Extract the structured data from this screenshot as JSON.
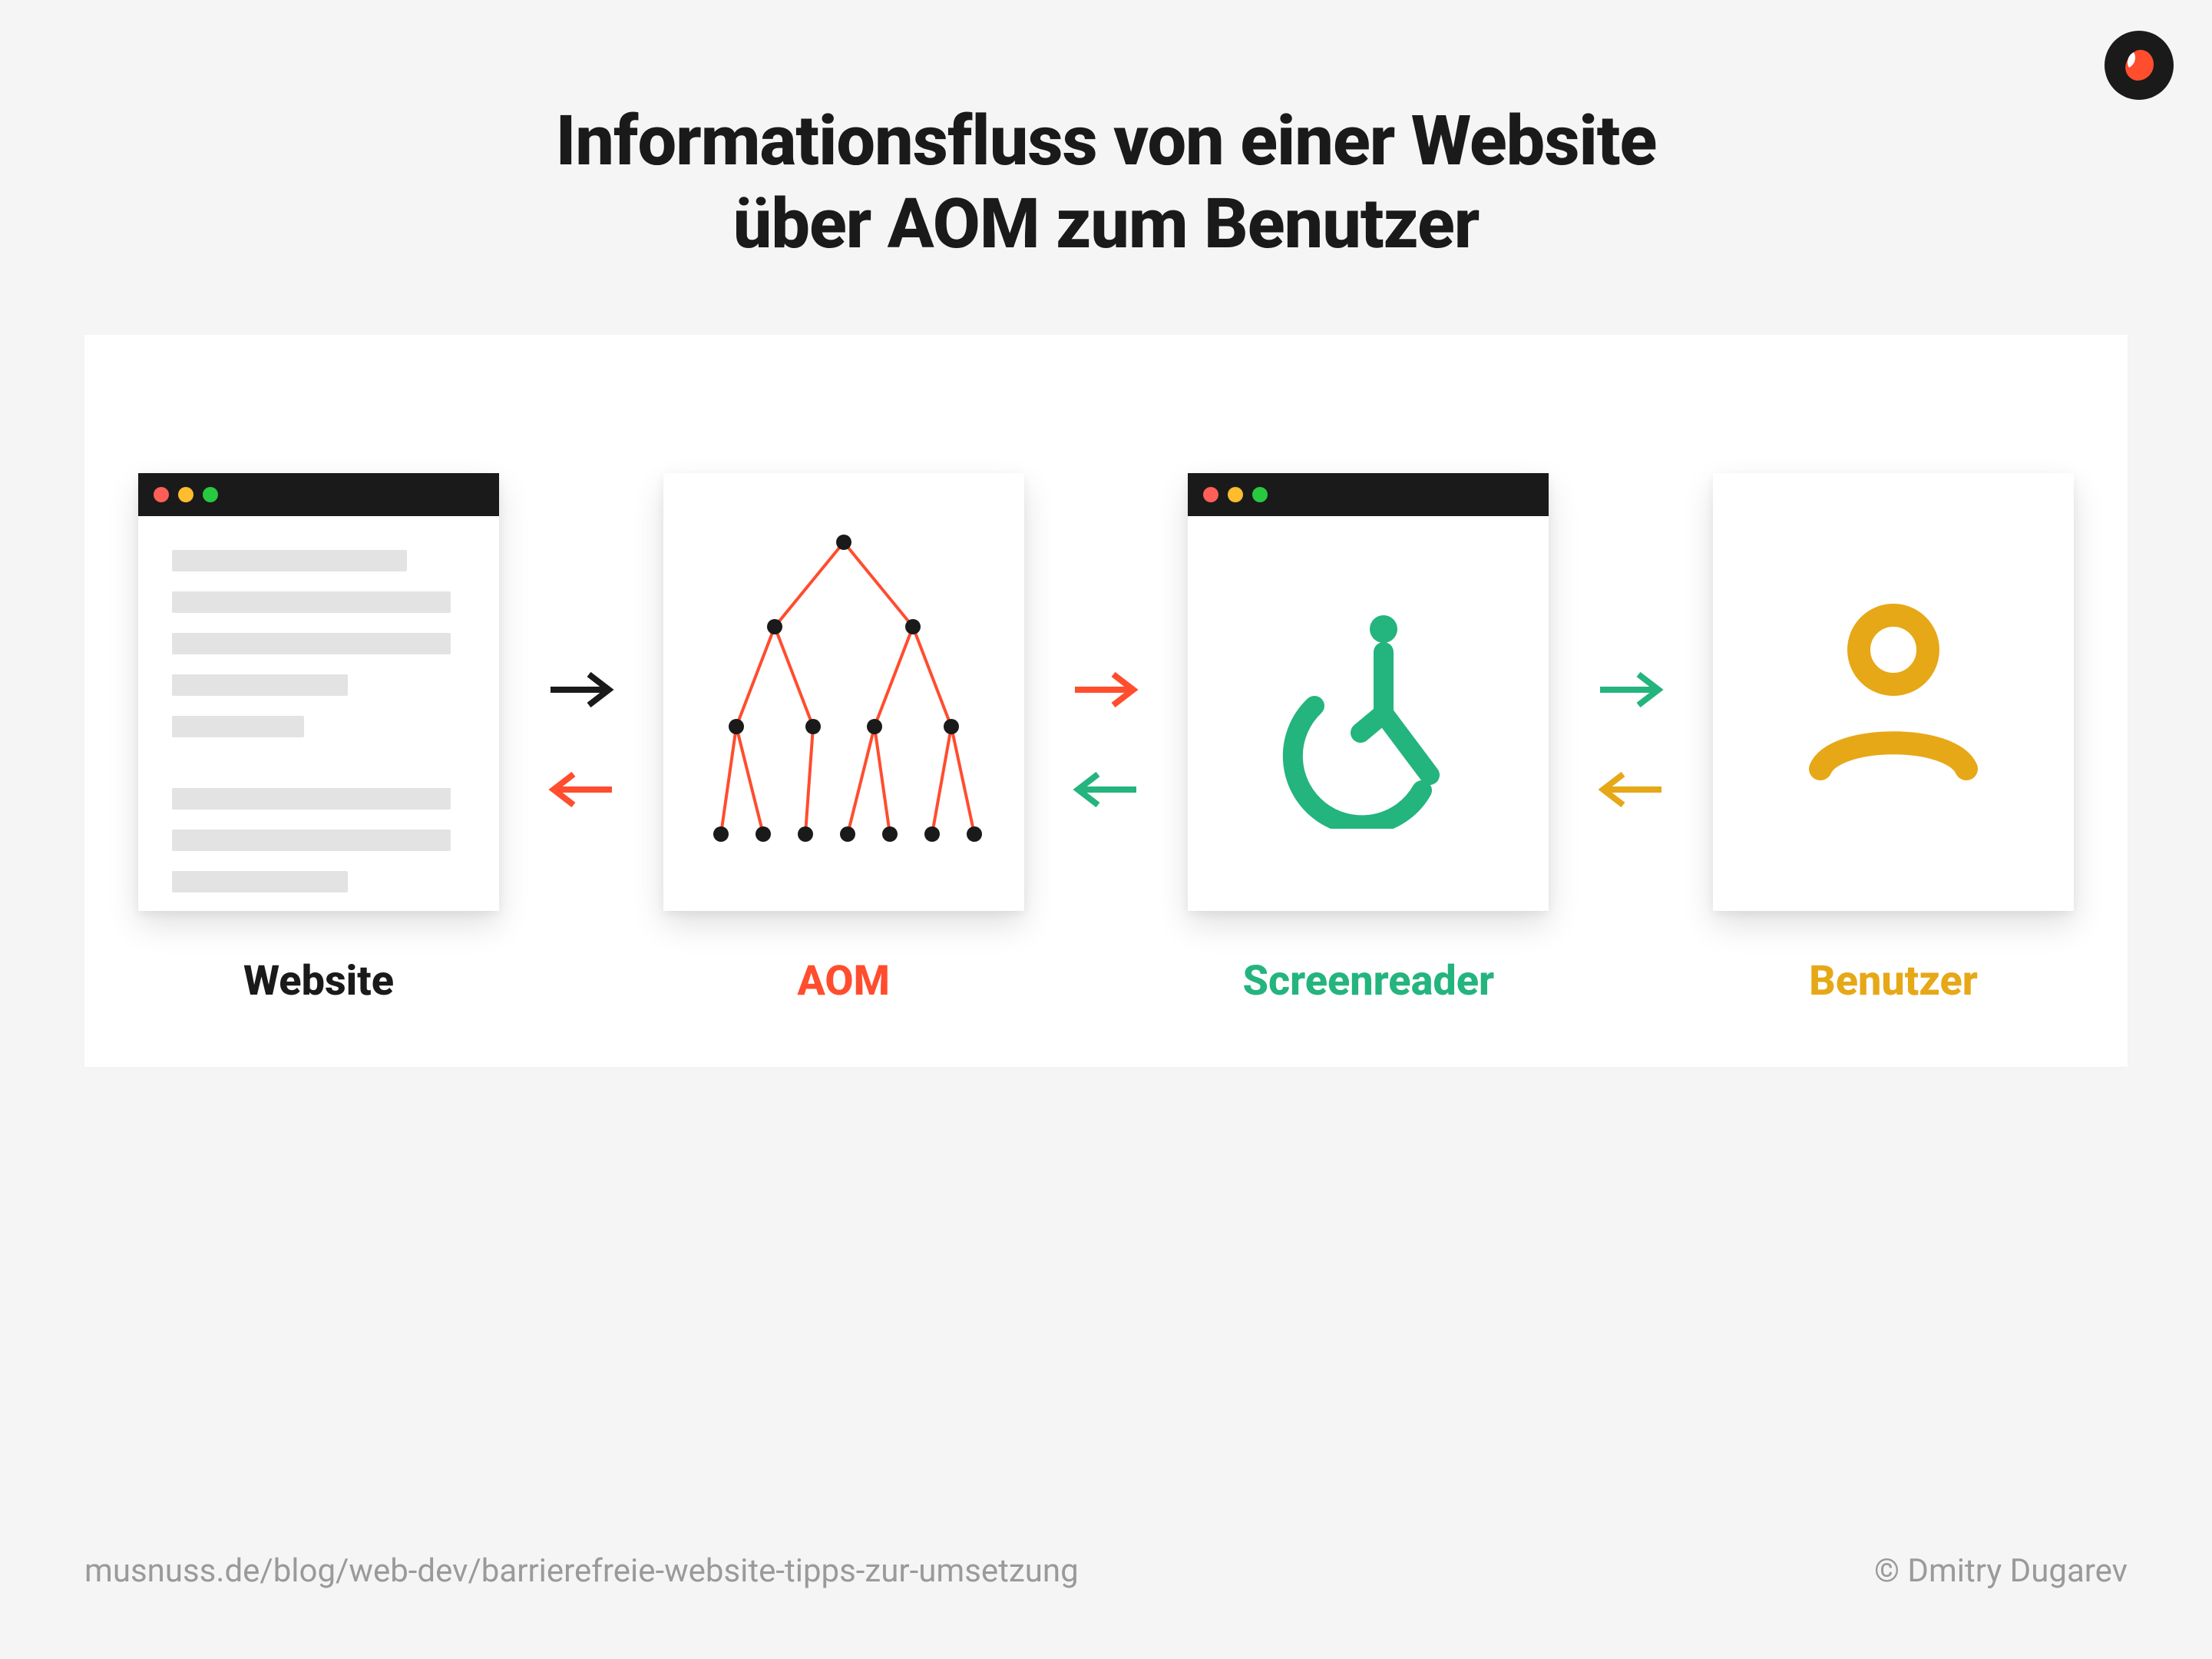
{
  "title_line1": "Informationsfluss von einer Website",
  "title_line2": "über AOM zum Benutzer",
  "steps": {
    "website": {
      "label": "Website",
      "color": "#1a1a1a"
    },
    "aom": {
      "label": "AOM",
      "color": "#ff4d2e"
    },
    "screenreader": {
      "label": "Screenreader",
      "color": "#24b47e"
    },
    "user": {
      "label": "Benutzer",
      "color": "#e6a817"
    }
  },
  "arrows": [
    {
      "forward_color": "#1a1a1a",
      "back_color": "#ff4d2e"
    },
    {
      "forward_color": "#ff4d2e",
      "back_color": "#24b47e"
    },
    {
      "forward_color": "#24b47e",
      "back_color": "#e6a817"
    }
  ],
  "footer": {
    "url": "musnuss.de/blog/web-dev/barrierefreie-website-tipps-zur-umsetzung",
    "credit": "© Dmitry Dugarev"
  },
  "colors": {
    "black": "#1a1a1a",
    "red": "#ff4d2e",
    "green": "#24b47e",
    "gold": "#e6a817",
    "grey_line": "#e3e3e3",
    "bg": "#f5f5f5"
  }
}
